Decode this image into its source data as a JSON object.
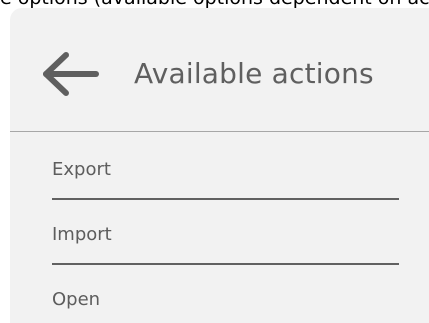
{
  "top_caption": "e options (available options dependent on active module).",
  "header": {
    "title": "Available actions",
    "back_icon": "arrow-left-icon"
  },
  "menu": {
    "items": [
      {
        "label": "Export"
      },
      {
        "label": "Import"
      },
      {
        "label": "Open"
      }
    ]
  }
}
